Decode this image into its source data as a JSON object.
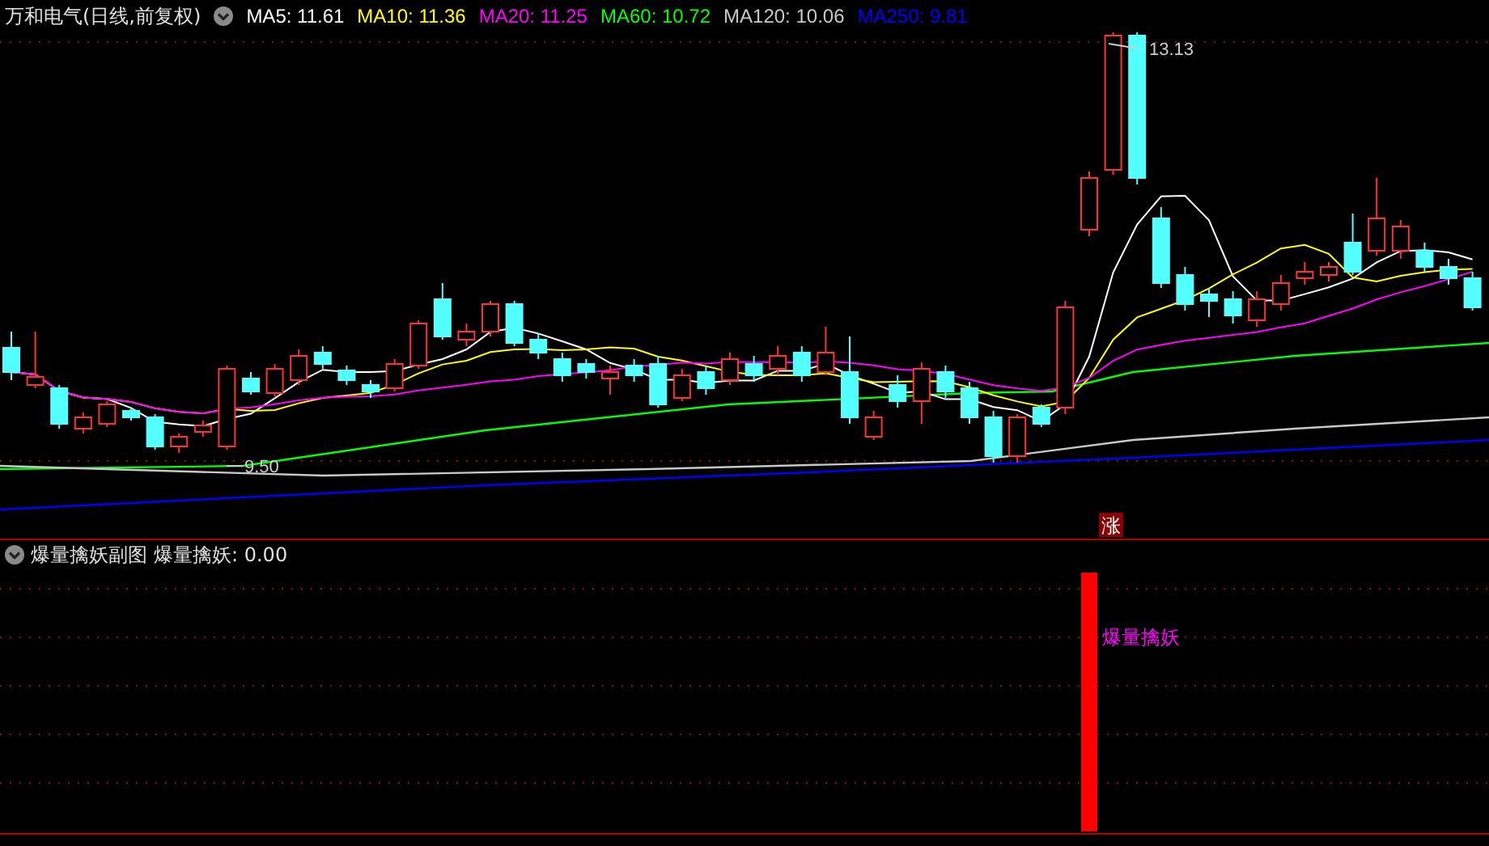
{
  "header": {
    "title": "万和电气(日线,前复权)",
    "indicators": [
      {
        "label": "MA5: 11.61",
        "color": "#ffffff"
      },
      {
        "label": "MA10: 11.36",
        "color": "#ffff00"
      },
      {
        "label": "MA20: 11.25",
        "color": "#ff00ff"
      },
      {
        "label": "MA60: 10.72",
        "color": "#00ff00"
      },
      {
        "label": "MA120: 10.06",
        "color": "#c8c8c8"
      },
      {
        "label": "MA250: 9.81",
        "color": "#0000ff"
      }
    ]
  },
  "main_chart": {
    "high_label": "13.13",
    "low_label": "9.50",
    "limit_up_badge": "涨"
  },
  "sub_chart": {
    "title": "爆量擒妖副图",
    "reading": "爆量擒妖: 0.00",
    "signal_label": "爆量擒妖"
  }
}
